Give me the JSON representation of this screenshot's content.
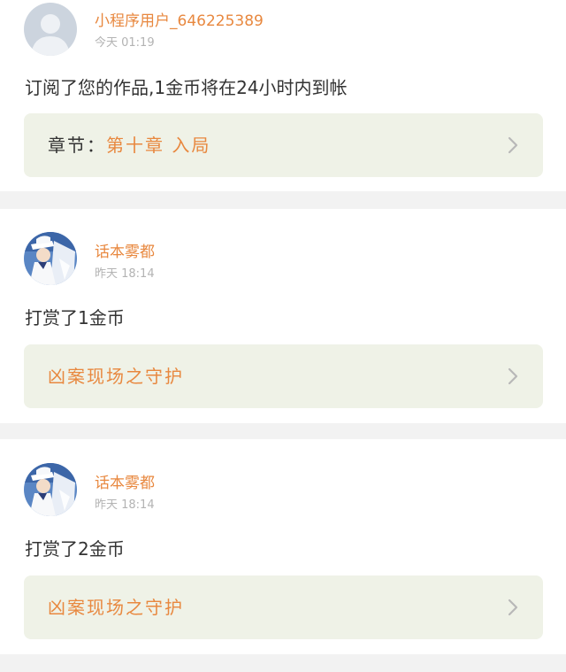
{
  "notifications": [
    {
      "username": "小程序用户_646225389",
      "time": "今天 01:19",
      "message": "订阅了您的作品,1金币将在24小时内到帐",
      "link_prefix": "章节：",
      "link_title": "第十章  入局",
      "avatar": "default-user-avatar"
    },
    {
      "username": "话本雾都",
      "time": "昨天 18:14",
      "message": "打赏了1金币",
      "link_prefix": "",
      "link_title": "凶案现场之守护",
      "avatar": "anime-character-avatar"
    },
    {
      "username": "话本雾都",
      "time": "昨天 18:14",
      "message": "打赏了2金币",
      "link_prefix": "",
      "link_title": "凶案现场之守护",
      "avatar": "anime-character-avatar"
    }
  ],
  "colors": {
    "accent": "#e8883f",
    "link_box_bg": "#eff2e7",
    "page_bg": "#f2f2f2",
    "time_text": "#b3b3b3"
  },
  "icons": {
    "chevron": "chevron-right-icon"
  }
}
